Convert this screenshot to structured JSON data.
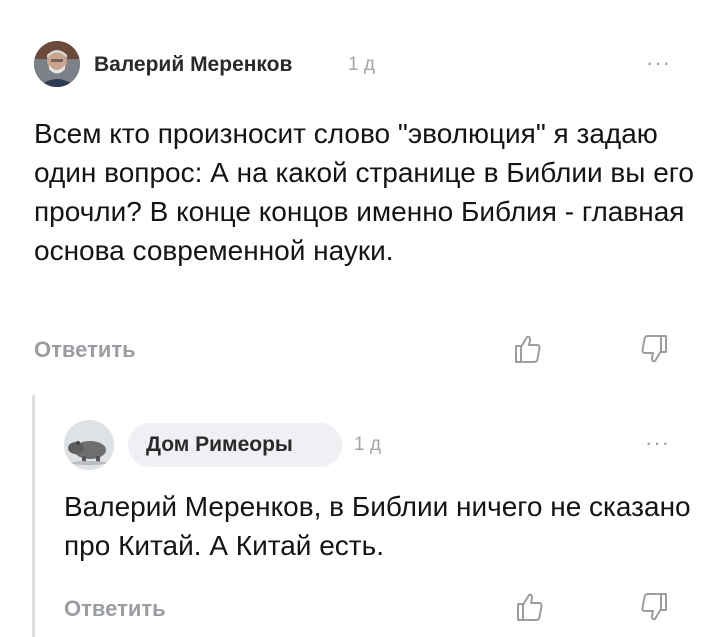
{
  "comments": [
    {
      "author": "Валерий Меренков",
      "time": "1 д",
      "text": "Всем кто произносит слово \"эволюция\" я задаю один вопрос: А на какой странице в Библии вы его прочли? В конце концов именно Библия - главная основа современной науки.",
      "reply_label": "Ответить",
      "more_label": "···"
    },
    {
      "author": "Дом Римеоры",
      "time": "1 д",
      "text": "Валерий Меренков, в Библии ничего не сказано про Китай. А Китай есть.",
      "reply_label": "Ответить",
      "more_label": "···"
    }
  ],
  "icons": {
    "like": "thumbs-up-outline-icon",
    "dislike": "thumbs-down-outline-icon",
    "more": "ellipsis-icon"
  },
  "colors": {
    "muted": "#9a9ea3",
    "chip_bg": "#eef0f3",
    "thread_line": "#dcdfe3"
  }
}
